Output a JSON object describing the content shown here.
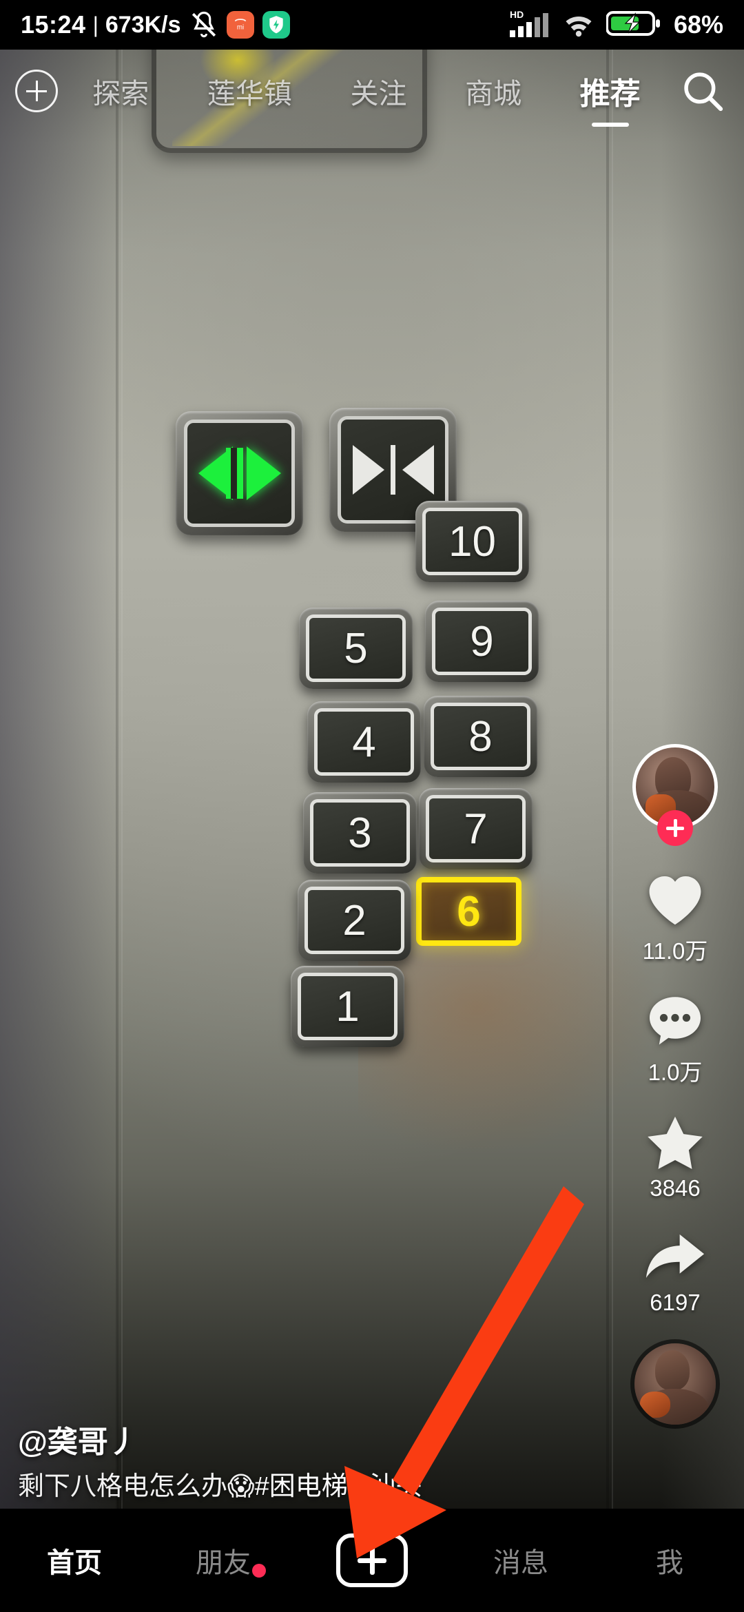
{
  "statusbar": {
    "time": "15:24",
    "separator": "|",
    "net_speed": "673K/s",
    "battery_percent": "68%",
    "icons": [
      "mute-bell-icon",
      "xiaomi-appstore-icon",
      "security-shield-icon",
      "hd-signal-icon",
      "wifi-icon",
      "battery-charging-icon"
    ]
  },
  "topnav": {
    "add_icon": "plus-circle-icon",
    "search_icon": "search-icon",
    "tabs": [
      {
        "label": "探索",
        "active": false
      },
      {
        "label": "莲华镇",
        "active": false
      },
      {
        "label": "关注",
        "active": false
      },
      {
        "label": "商城",
        "active": false
      },
      {
        "label": "推荐",
        "active": true
      }
    ]
  },
  "video": {
    "door_open_button": "开门",
    "door_close_button": "关门",
    "floors_left": [
      "5",
      "4",
      "3",
      "2",
      "1"
    ],
    "floors_right": [
      "10",
      "9",
      "8",
      "7",
      "6"
    ],
    "lit_floor": "6"
  },
  "rail": {
    "avatar_name": "author-avatar",
    "follow_label": "+",
    "actions": [
      {
        "icon": "heart-icon",
        "count": "11.0万"
      },
      {
        "icon": "comment-icon",
        "count": "1.0万"
      },
      {
        "icon": "star-icon",
        "count": "3846"
      },
      {
        "icon": "share-icon",
        "count": "6197"
      }
    ],
    "music_disc": "music-disc-avatar"
  },
  "caption": {
    "username": "@䶮哥丿",
    "text": "剩下八格电怎么办😱",
    "hashtag1": "#困电梯",
    "hashtag2": "#汕头"
  },
  "annotation": {
    "arrow_color": "#fa3c12",
    "points_to": "create-post-button"
  },
  "bottombar": {
    "items": [
      {
        "label": "首页",
        "active": true,
        "badge": false
      },
      {
        "label": "朋友",
        "active": false,
        "badge": true
      },
      {
        "label": "",
        "active": false,
        "badge": false
      },
      {
        "label": "消息",
        "active": false,
        "badge": false
      },
      {
        "label": "我",
        "active": false,
        "badge": false
      }
    ],
    "create_icon": "plus-icon"
  },
  "colors": {
    "accent_red": "#fe2c55",
    "annotation_red": "#fa3c12",
    "lit_yellow": "#ffe712",
    "door_green": "#1cf03c"
  }
}
